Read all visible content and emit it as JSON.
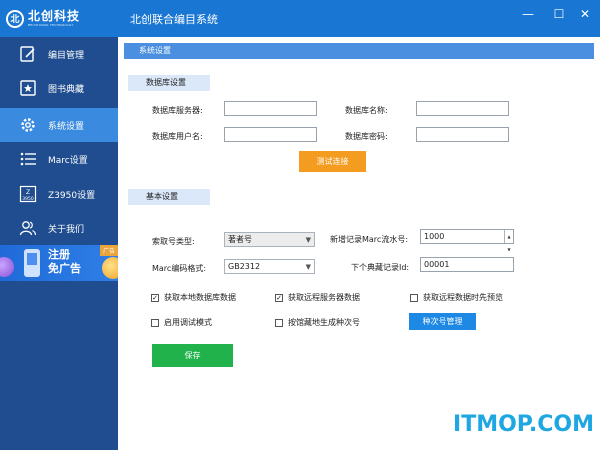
{
  "window": {
    "logo_mark": "北",
    "logo_main": "北创科技",
    "logo_sub": "BEICHUANG TECHNOLOGY",
    "title": "北创联合编目系统",
    "minimize": "—",
    "maximize": "☐",
    "close": "✕"
  },
  "sidebar": {
    "items": [
      {
        "label": "编目管理",
        "icon": "edit-icon"
      },
      {
        "label": "图书典藏",
        "icon": "star-book-icon"
      },
      {
        "label": "系统设置",
        "icon": "gear-icon"
      },
      {
        "label": "Marc设置",
        "icon": "list-icon"
      },
      {
        "label": "Z3950设置",
        "icon": "z3950-icon"
      },
      {
        "label": "关于我们",
        "icon": "users-icon"
      }
    ],
    "active_index": 2,
    "z_icon_text": "Z\n3950",
    "ad": {
      "tag": "广告",
      "line1": "注册",
      "line2": "免广告"
    }
  },
  "panel": {
    "title": "系统设置",
    "db_section": {
      "title": "数据库设置",
      "server_label": "数据库服务器:",
      "server_value": "",
      "name_label": "数据库名称:",
      "name_value": "",
      "user_label": "数据库用户名:",
      "user_value": "",
      "password_label": "数据库密码:",
      "password_value": "",
      "test_button": "测试连接"
    },
    "basic_section": {
      "title": "基本设置",
      "index_type_label": "索取号类型:",
      "index_type_value": "著者号",
      "marc_serial_label": "新增记录Marc流水号:",
      "marc_serial_value": "1000",
      "marc_encoding_label": "Marc编码格式:",
      "marc_encoding_value": "GB2312",
      "next_record_label": "下个典藏记录Id:",
      "next_record_value": "00001",
      "checkboxes": [
        {
          "label": "获取本地数据库数据",
          "checked": true
        },
        {
          "label": "获取远程服务器数据",
          "checked": true
        },
        {
          "label": "获取远程数据时先预览",
          "checked": false
        },
        {
          "label": "启用调试模式",
          "checked": false
        },
        {
          "label": "按馆藏地生成种次号",
          "checked": false
        }
      ],
      "seq_button": "种次号管理",
      "save_button": "保存"
    }
  },
  "watermark": "ITMOP.COM",
  "colors": {
    "titlebar": "#1976d2",
    "sidebar": "#1f4d8f",
    "active": "#3a8be0",
    "test_btn": "#f39c1f",
    "seq_btn": "#1e88e5",
    "save_btn": "#21b24b"
  }
}
